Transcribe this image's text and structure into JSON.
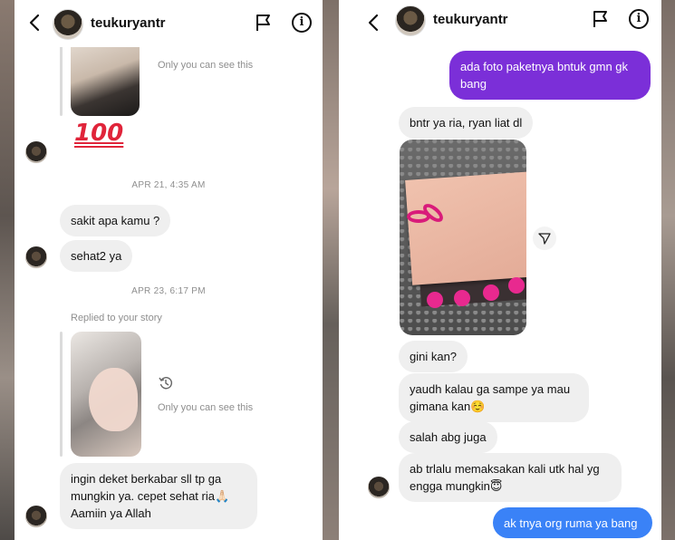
{
  "left_chat": {
    "header": {
      "username": "teukuryantr"
    },
    "story_note_top": "Only you can see this",
    "emoji_100": "💯",
    "timestamp_1": "APR 21, 4:35 AM",
    "msg_1": "sakit apa kamu ?",
    "msg_2": "sehat2 ya",
    "timestamp_2": "APR 23, 6:17 PM",
    "replied_label": "Replied to your story",
    "story_note_bottom": "Only you can see this",
    "msg_3": "ingin deket berkabar sll tp ga mungkin ya. cepet sehat ria🙏🏻 Aamiin ya Allah"
  },
  "right_chat": {
    "header": {
      "username": "teukuryantr"
    },
    "msg_out_1": "ada foto paketnya bntuk gmn gk bang",
    "msg_in_1": "bntr ya ria, ryan liat dl",
    "msg_in_2": "gini kan?",
    "msg_in_3": "yaudh kalau ga sampe ya mau gimana kan☺️",
    "msg_in_4": "salah abg juga",
    "msg_in_5": "ab trlalu memaksakan kali utk hal yg engga mungkin😇",
    "msg_out_2": "ak tnya org ruma ya bang"
  },
  "colors": {
    "outgoing_purple": "#7b2fd8",
    "outgoing_blue": "#3a82f7",
    "incoming_gray": "#efefef",
    "timestamp_gray": "#8e8e8e"
  },
  "icons": [
    "back-chevron-icon",
    "flag-icon",
    "info-icon",
    "reply-history-icon",
    "share-send-icon"
  ]
}
